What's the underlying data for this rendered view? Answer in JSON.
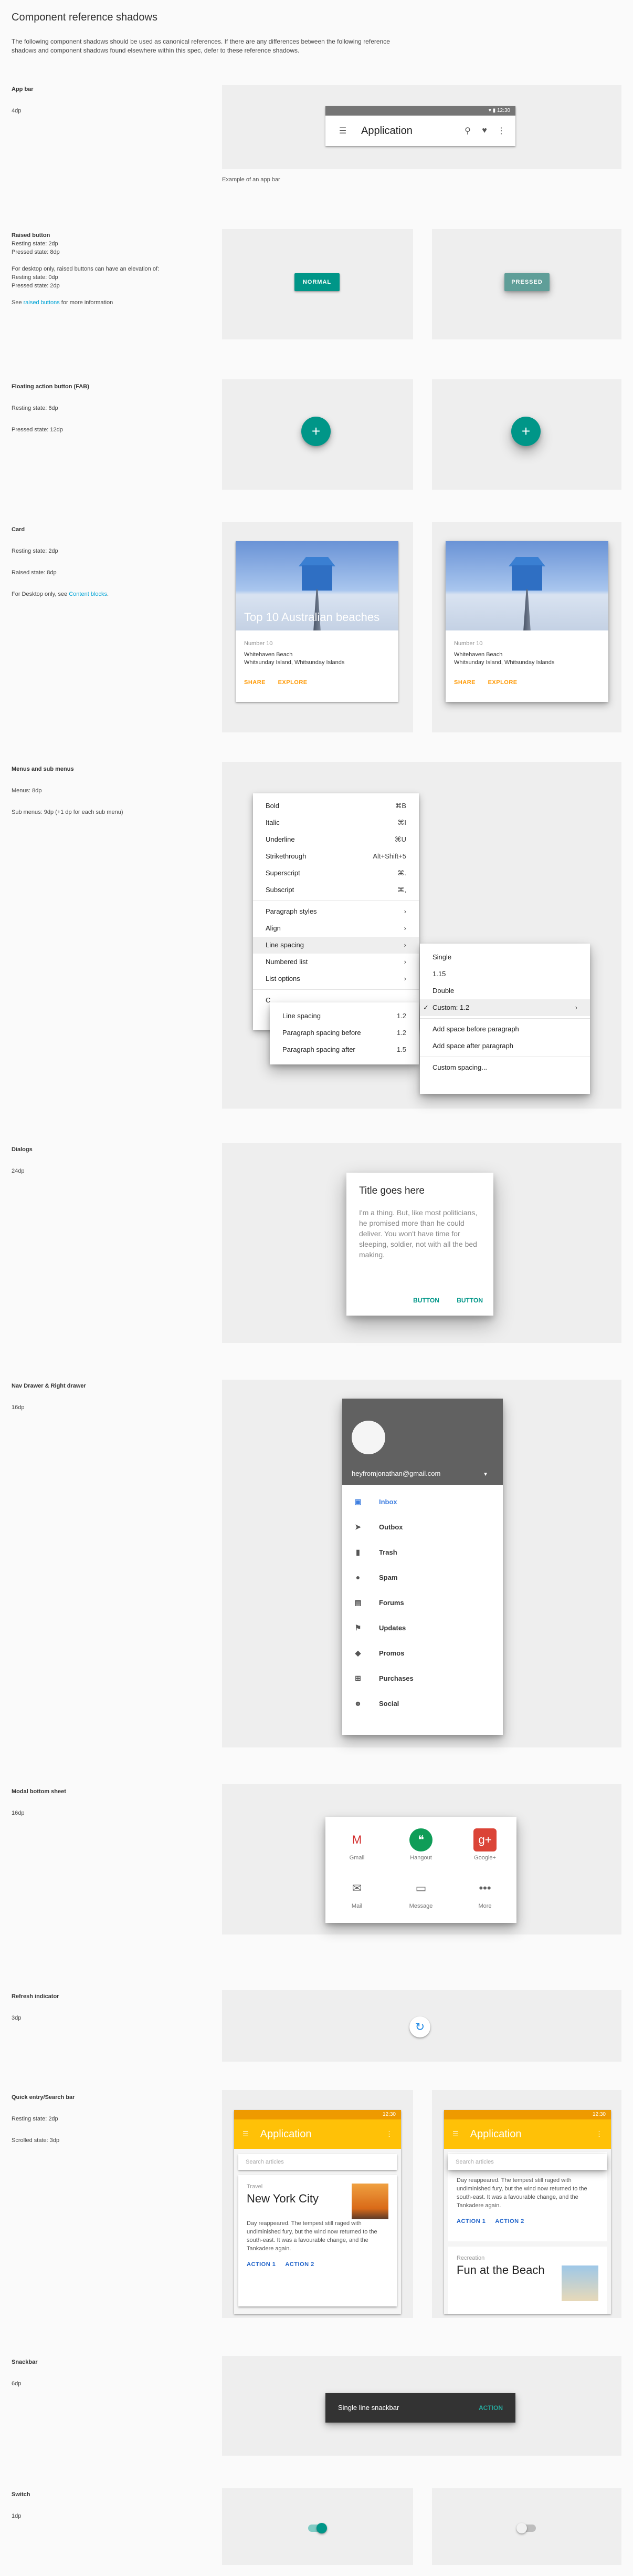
{
  "intro": {
    "title": "Component reference shadows",
    "text": "The following component shadows should be used as canonical references. If there are any differences between the following reference shadows and component shadows found elsewhere within this spec, defer to these reference shadows."
  },
  "appbar": {
    "label": "App bar",
    "spec": "4dp",
    "time": "12:30",
    "title": "Application",
    "caption": "Example of an app bar"
  },
  "raised": {
    "label": "Raised button",
    "resting": "Resting state: 2dp",
    "pressed": "Pressed state: 8dp",
    "desktop": "For desktop only, raised buttons can have an elevation of:",
    "d_resting": "Resting state: 0dp",
    "d_pressed": "Pressed state: 2dp",
    "see_pre": "See ",
    "see_link": "raised buttons",
    "see_post": " for more information",
    "normal_label": "NORMAL",
    "pressed_label": "PRESSED"
  },
  "fab": {
    "label": "Floating action button (FAB)",
    "resting": "Resting state: 6dp",
    "pressed": "Pressed state: 12dp",
    "glyph": "+"
  },
  "card": {
    "label": "Card",
    "resting": "Resting state: 2dp",
    "raised": "Raised state: 8dp",
    "desktop_pre": "For Desktop only, see ",
    "desktop_link": "Content blocks",
    "desktop_post": ".",
    "image_title": "Top 10 Australian beaches",
    "number": "Number 10",
    "place": "Whitehaven Beach",
    "location": "Whitsunday Island, Whitsunday Islands",
    "share": "SHARE",
    "explore": "EXPLORE"
  },
  "menus": {
    "label": "Menus and sub menus",
    "menu_spec": "Menus: 8dp",
    "sub_spec": "Sub menus: 9dp (+1 dp for each sub menu)",
    "main": [
      {
        "label": "Bold",
        "key": "⌘B"
      },
      {
        "label": "Italic",
        "key": "⌘I"
      },
      {
        "label": "Underline",
        "key": "⌘U"
      },
      {
        "label": "Strikethrough",
        "key": "Alt+Shift+5"
      },
      {
        "label": "Superscript",
        "key": "⌘."
      },
      {
        "label": "Subscript",
        "key": "⌘,"
      },
      {
        "label": "Paragraph styles",
        "key": "›"
      },
      {
        "label": "Align",
        "key": "›"
      },
      {
        "label": "Line spacing",
        "key": "›"
      },
      {
        "label": "Numbered list",
        "key": "›"
      },
      {
        "label": "List options",
        "key": "›"
      }
    ],
    "sub1": [
      {
        "label": "Line spacing",
        "key": "1.2"
      },
      {
        "label": "Paragraph spacing before",
        "key": "1.2"
      },
      {
        "label": "Paragraph spacing after",
        "key": "1.5"
      }
    ],
    "sub2": [
      {
        "label": "Single"
      },
      {
        "label": "1.15"
      },
      {
        "label": "Double"
      },
      {
        "label": "Custom: 1.2"
      },
      {
        "label": "Add space before paragraph"
      },
      {
        "label": "Add space after paragraph"
      },
      {
        "label": "Custom spacing..."
      }
    ],
    "check": "✓",
    "arrow": "›",
    "clear": "C"
  },
  "dialogs": {
    "label": "Dialogs",
    "spec": "24dp",
    "title": "Title goes here",
    "body": "I'm a thing. But, like most politicians, he promised more than he could deliver. You won't have time for sleeping, soldier, not with all the bed making.",
    "btn1": "BUTTON",
    "btn2": "BUTTON"
  },
  "drawer": {
    "label": "Nav Drawer & Right drawer",
    "spec": "16dp",
    "email": "heyfromjonathan@gmail.com",
    "items": [
      "Inbox",
      "Outbox",
      "Trash",
      "Spam",
      "Forums",
      "Updates",
      "Promos",
      "Purchases",
      "Social"
    ]
  },
  "sheet": {
    "label": "Modal bottom sheet",
    "spec": "16dp",
    "items": [
      "Gmail",
      "Hangout",
      "Google+",
      "Mail",
      "Message",
      "More"
    ]
  },
  "refresh": {
    "label": "Refresh indicator",
    "spec": "3dp"
  },
  "search": {
    "label": "Quick entry/Search bar",
    "resting": "Resting state: 2dp",
    "scrolled": "Scrolled state: 3dp",
    "time": "12:30",
    "title": "Application",
    "placeholder": "Search articles",
    "category": "Travel",
    "headline": "New York City",
    "text": "Day reappeared. The tempest still raged with undiminished fury, but the wind now returned to the south-east. It was a favourable change, and the Tankadere again.",
    "action1": "ACTION 1",
    "action2": "ACTION 2",
    "category2": "Recreation",
    "headline2": "Fun at the Beach"
  },
  "snackbar": {
    "label": "Snackbar",
    "spec": "6dp",
    "text": "Single line snackbar",
    "action": "ACTION"
  },
  "switch": {
    "label": "Switch",
    "spec": "1dp"
  },
  "colors": {
    "teal": "#009688",
    "amber": "#ffc107",
    "link": "#00a4d6"
  }
}
